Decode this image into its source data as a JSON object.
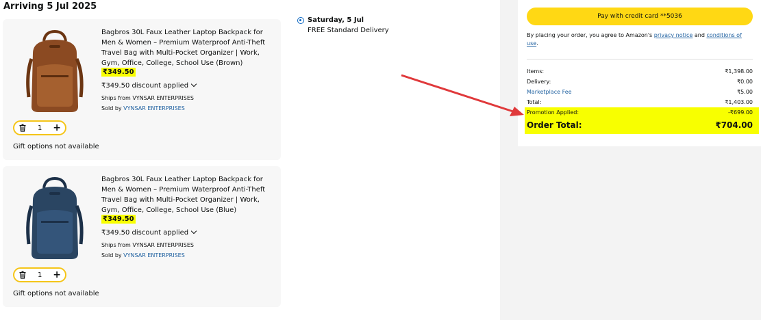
{
  "header": {
    "arriving": "Arriving 5 Jul 2025"
  },
  "items": [
    {
      "title": "Bagbros 30L Faux Leather Laptop Backpack for Men & Women – Premium Waterproof Anti-Theft Travel Bag with Multi-Pocket Organizer | Work, Gym, Office, College, School Use (Brown)",
      "price": "₹349.50",
      "discount": "₹349.50 discount applied",
      "ships_from": "Ships from VYNSAR ENTERPRISES",
      "sold_by_label": "Sold by ",
      "seller": "VYNSAR ENTERPRISES",
      "quantity": "1",
      "gift": "Gift options not available",
      "color": "#8b4a22"
    },
    {
      "title": "Bagbros 30L Faux Leather Laptop Backpack for Men & Women – Premium Waterproof Anti-Theft Travel Bag with Multi-Pocket Organizer | Work, Gym, Office, College, School Use (Blue)",
      "price": "₹349.50",
      "discount": "₹349.50 discount applied",
      "ships_from": "Ships from VYNSAR ENTERPRISES",
      "sold_by_label": "Sold by ",
      "seller": "VYNSAR ENTERPRISES",
      "quantity": "1",
      "gift": "Gift options not available",
      "color": "#2a4562"
    }
  ],
  "delivery": {
    "day": "Saturday, 5 Jul",
    "type": "FREE Standard Delivery"
  },
  "summary": {
    "pay_button": "Pay with credit card **5036",
    "consent_prefix": "By placing your order, you agree to Amazon's ",
    "privacy_link": "privacy notice",
    "consent_and": " and ",
    "conditions_link": "conditions of use",
    "consent_suffix": ".",
    "rows": [
      {
        "label": "Items:",
        "value": "₹1,398.00"
      },
      {
        "label": "Delivery:",
        "value": "₹0.00"
      },
      {
        "label": "Marketplace Fee",
        "value": "₹5.00"
      },
      {
        "label": "Total:",
        "value": "₹1,403.00"
      },
      {
        "label": "Promotion Applied:",
        "value": "-₹699.00"
      }
    ],
    "order_total_label": "Order Total:",
    "order_total_value": "₹704.00"
  },
  "colors": {
    "accent_yellow": "#ffd814",
    "highlight": "#f8ff00",
    "link": "#2162a1",
    "arrow": "#e0393b"
  }
}
